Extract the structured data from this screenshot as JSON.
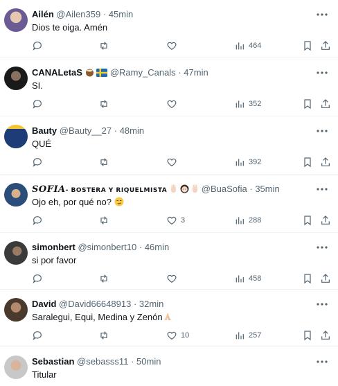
{
  "tweets": [
    {
      "name": "Ailén",
      "handle": "@Ailen359",
      "sep": "·",
      "time": "45min",
      "text": "Dios te oiga. Amén",
      "likes": "",
      "views": "464",
      "avatar_color": "#6b5b95"
    },
    {
      "name": "CANALetaS",
      "handle": "@Ramy_Canals",
      "sep": "·",
      "time": "47min",
      "text": "SI.",
      "likes": "",
      "views": "352",
      "avatar_color": "#1a1a1a"
    },
    {
      "name": "Bauty",
      "handle": "@Bauty__27",
      "sep": "·",
      "time": "48min",
      "text": "QUÉ",
      "likes": "",
      "views": "392",
      "avatar_color": "#1d3c78"
    },
    {
      "name_main": "SOFIA",
      "name_rest": "- BOSTERA Y RIQUELMISTA",
      "handle": "@BuaSofia",
      "sep": "·",
      "time": "35min",
      "text": "Ojo eh, por qué no?",
      "likes": "3",
      "views": "288",
      "avatar_color": "#2a4d7a"
    },
    {
      "name": "simonbert",
      "handle": "@simonbert10",
      "sep": "·",
      "time": "46min",
      "text": "si por favor",
      "likes": "",
      "views": "458",
      "avatar_color": "#3b3b3b"
    },
    {
      "name": "David",
      "handle": "@David66648913",
      "sep": "·",
      "time": "32min",
      "text": "Saralegui, Equi, Medina y Zenón",
      "likes": "10",
      "views": "257",
      "avatar_color": "#4a3a2e"
    },
    {
      "name": "Sebastian",
      "handle": "@sebasss11",
      "sep": "·",
      "time": "50min",
      "text": "Titular",
      "likes": "",
      "views": "",
      "avatar_color": "#c8c8c8"
    }
  ],
  "icons": {
    "reply": "reply-icon",
    "retweet": "retweet-icon",
    "like": "heart-icon",
    "views": "views-chart-icon",
    "bookmark": "bookmark-icon",
    "share": "share-icon",
    "more": "more-dots-icon"
  },
  "colors": {
    "text": "#0f1419",
    "secondary": "#536471",
    "divider": "#eff3f4"
  }
}
